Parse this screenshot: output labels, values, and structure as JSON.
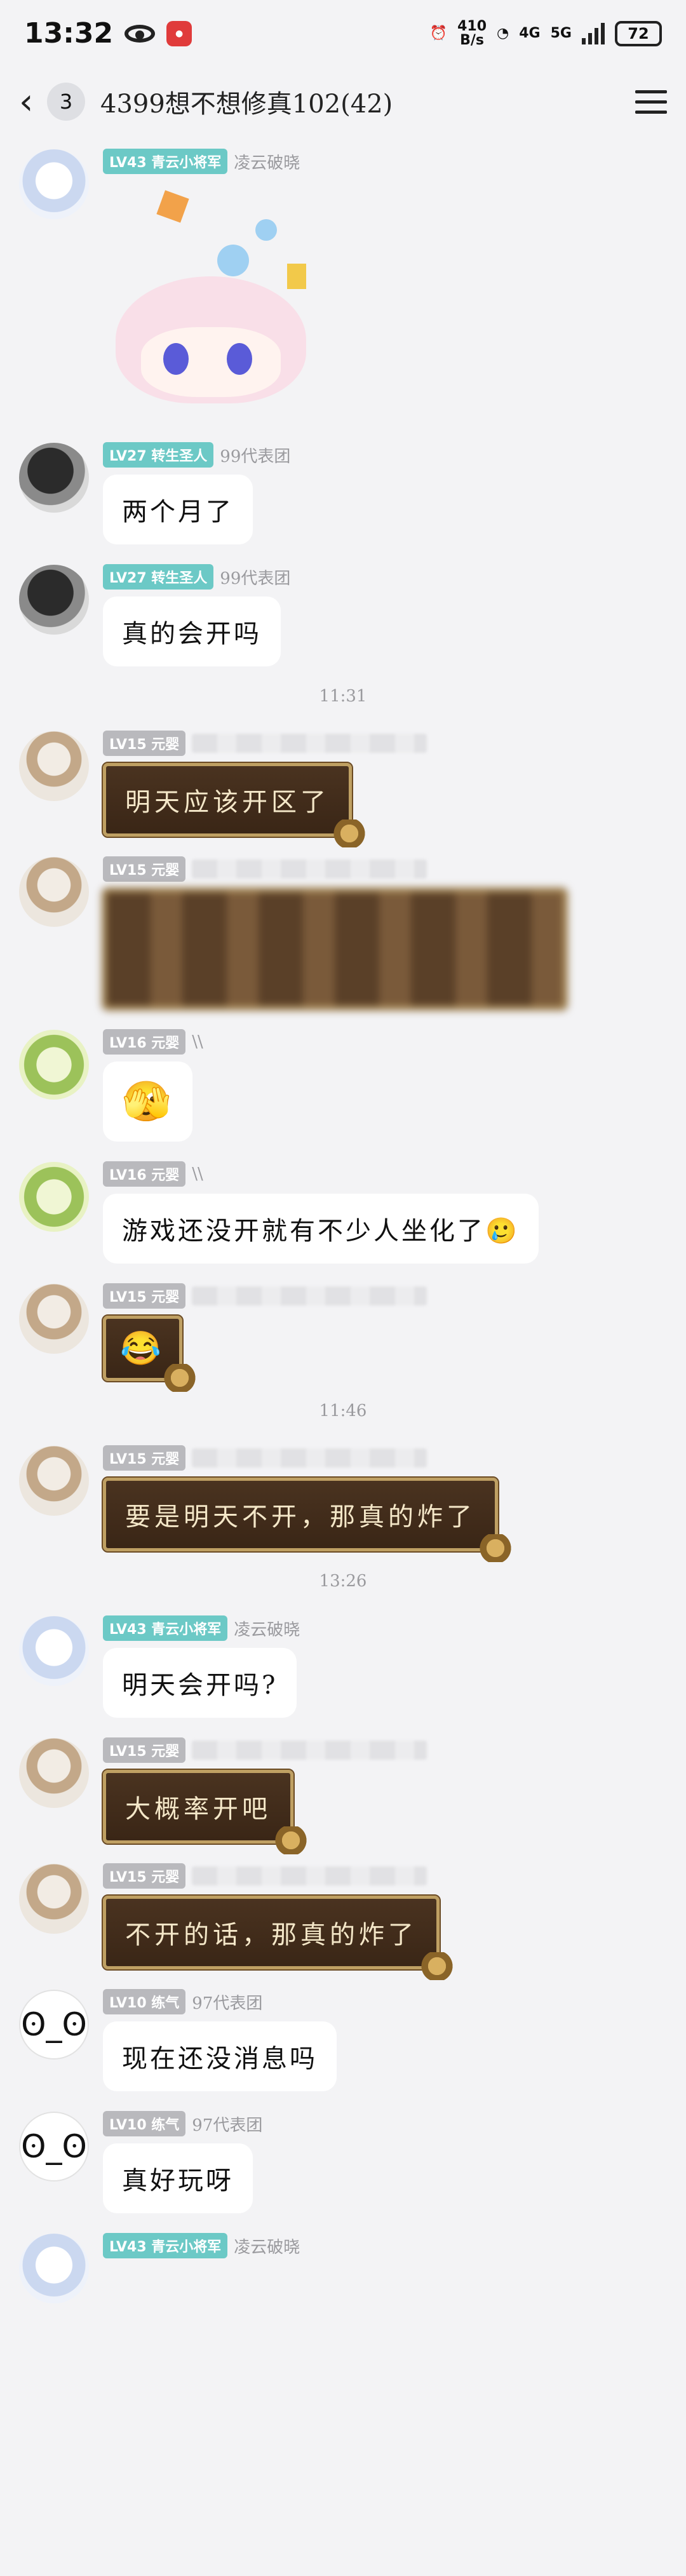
{
  "status": {
    "time": "13:32",
    "net_speed_top": "410",
    "net_speed_bottom": "B/s",
    "network_a": "4G",
    "network_b": "5G",
    "battery": "72"
  },
  "header": {
    "unread_count": "3",
    "title": "4399想不想修真102(42)"
  },
  "timestamps": [
    "11:31",
    "11:46",
    "13:26"
  ],
  "messages": [
    {
      "level": "LV43 青云小将军",
      "nick": "凌云破晓",
      "type": "sticker"
    },
    {
      "level": "LV27 转生圣人",
      "nick": "99代表团",
      "text": "两个月了"
    },
    {
      "level": "LV27 转生圣人",
      "nick": "99代表团",
      "text": "真的会开吗"
    },
    {
      "level": "LV15 元婴",
      "text": "明天应该开区了"
    },
    {
      "level": "LV15 元婴"
    },
    {
      "level": "LV16 元婴",
      "nick": "\\\\",
      "text": "🫣"
    },
    {
      "level": "LV16 元婴",
      "nick": "\\\\",
      "text": "游戏还没开就有不少人坐化了",
      "emoji": "🥲"
    },
    {
      "level": "LV15 元婴",
      "text": "😂"
    },
    {
      "level": "LV15 元婴",
      "text": "要是明天不开，那真的炸了"
    },
    {
      "level": "LV43 青云小将军",
      "nick": "凌云破晓",
      "text": "明天会开吗?"
    },
    {
      "level": "LV15 元婴",
      "text": "大概率开吧"
    },
    {
      "level": "LV15 元婴",
      "text": "不开的话，那真的炸了"
    },
    {
      "level": "LV10 练气",
      "nick": "97代表团",
      "text": "现在还没消息吗"
    },
    {
      "level": "LV10 练气",
      "nick": "97代表团",
      "text": "真好玩呀"
    },
    {
      "level": "LV43 青云小将军",
      "nick": "凌云破晓"
    }
  ]
}
